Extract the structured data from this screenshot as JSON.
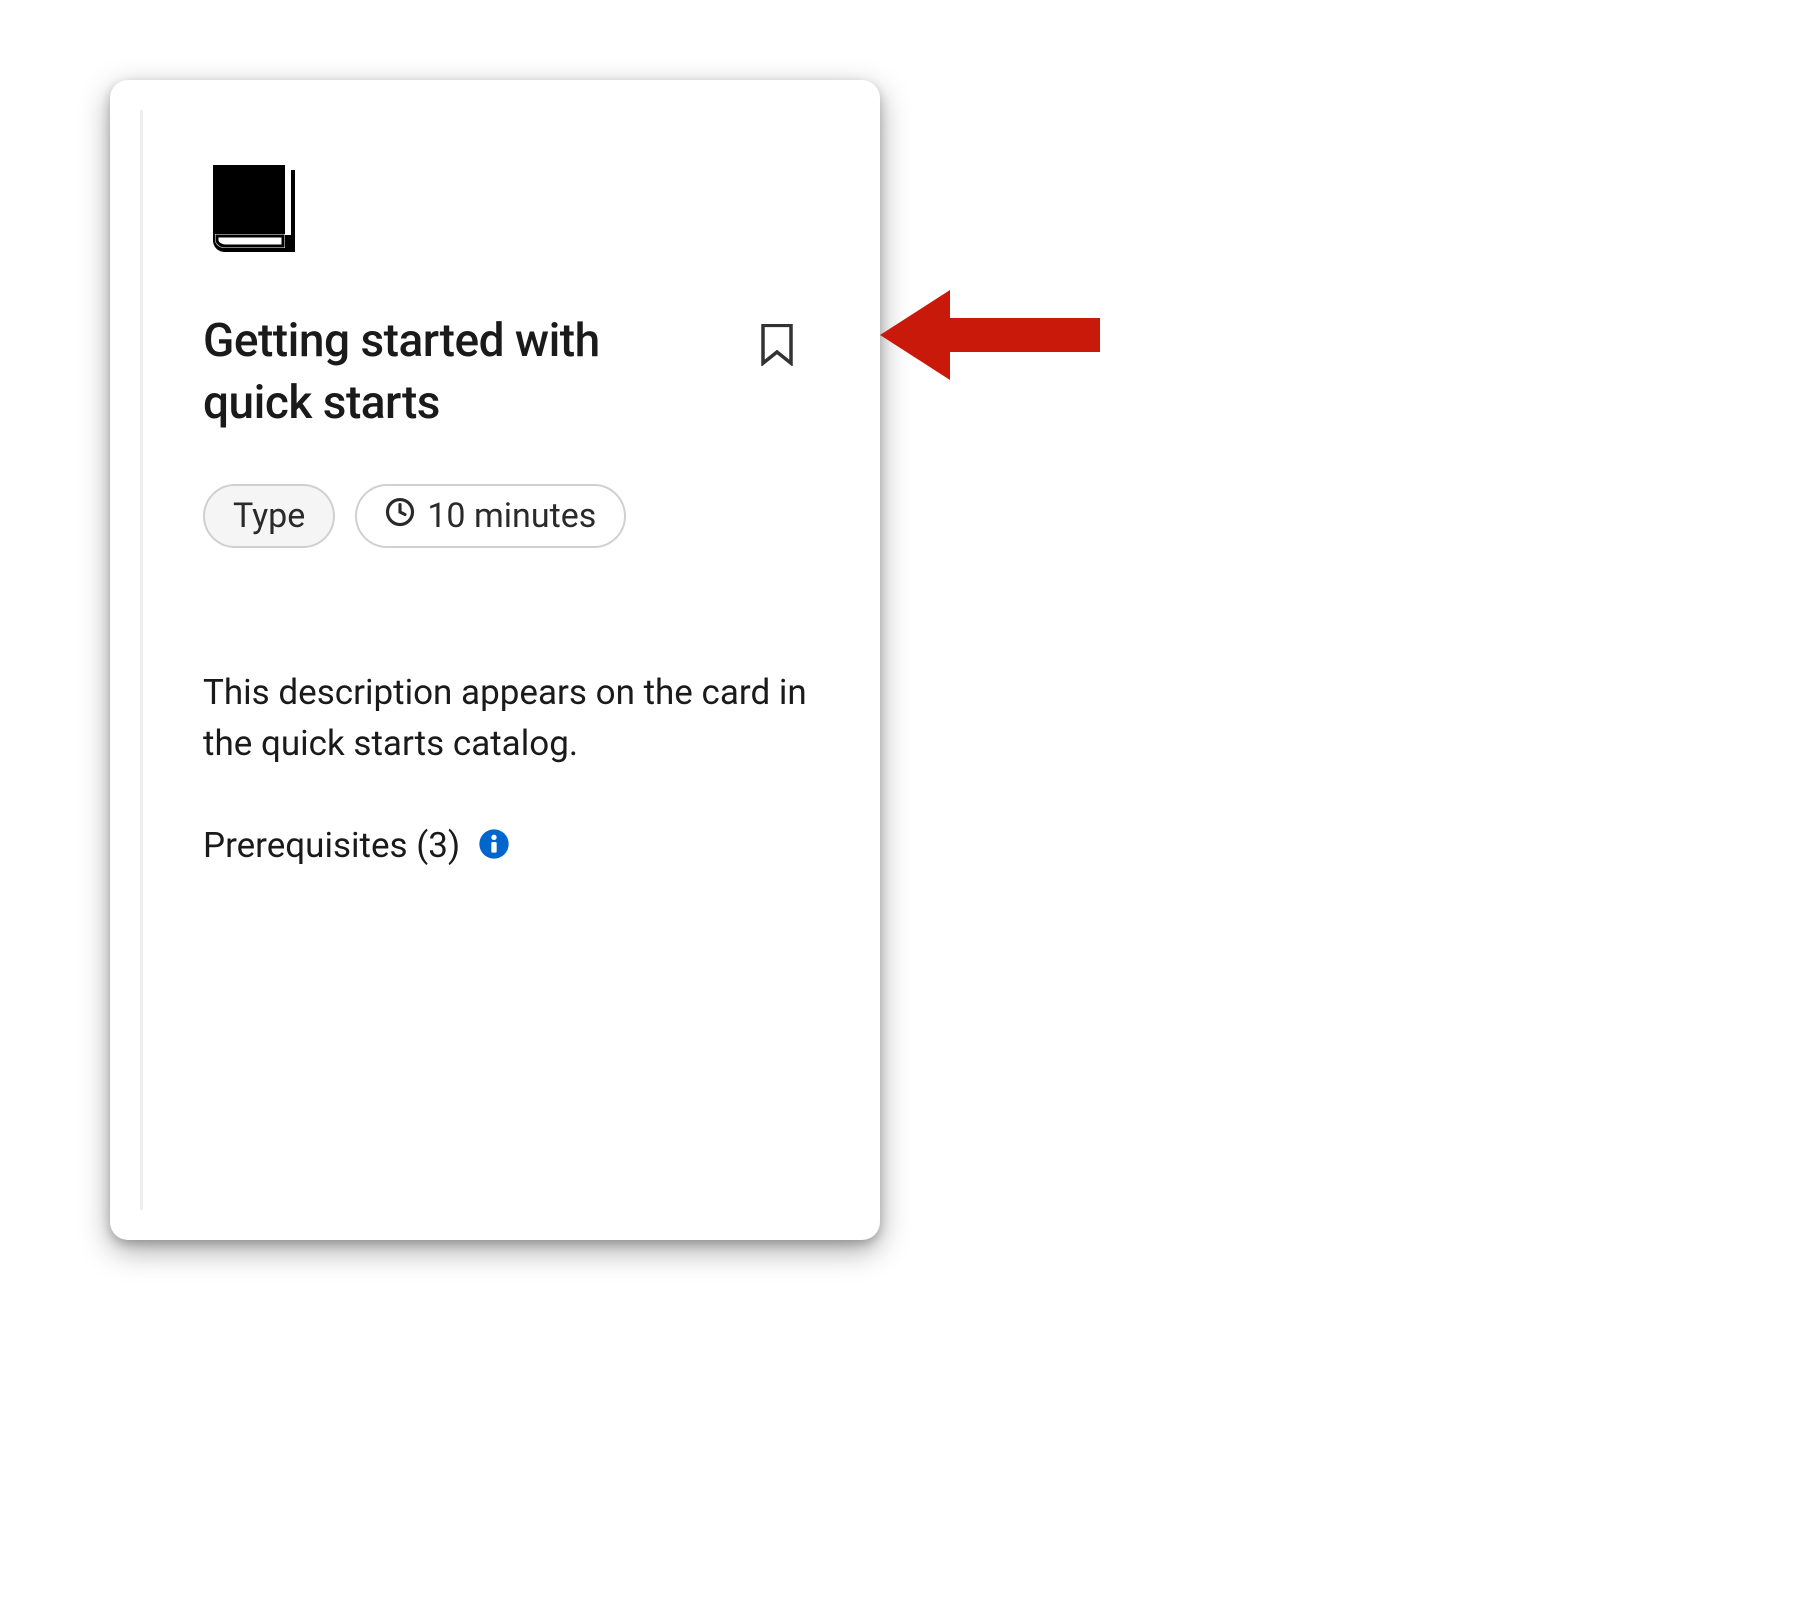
{
  "card": {
    "title": "Getting started with quick starts",
    "badges": {
      "type_label": "Type",
      "duration_label": "10 minutes"
    },
    "description": "This description appears on the card in the quick starts catalog.",
    "prerequisites_label": "Prerequisites (3)"
  },
  "colors": {
    "info_icon": "#0066cc",
    "arrow": "#c9190b"
  }
}
